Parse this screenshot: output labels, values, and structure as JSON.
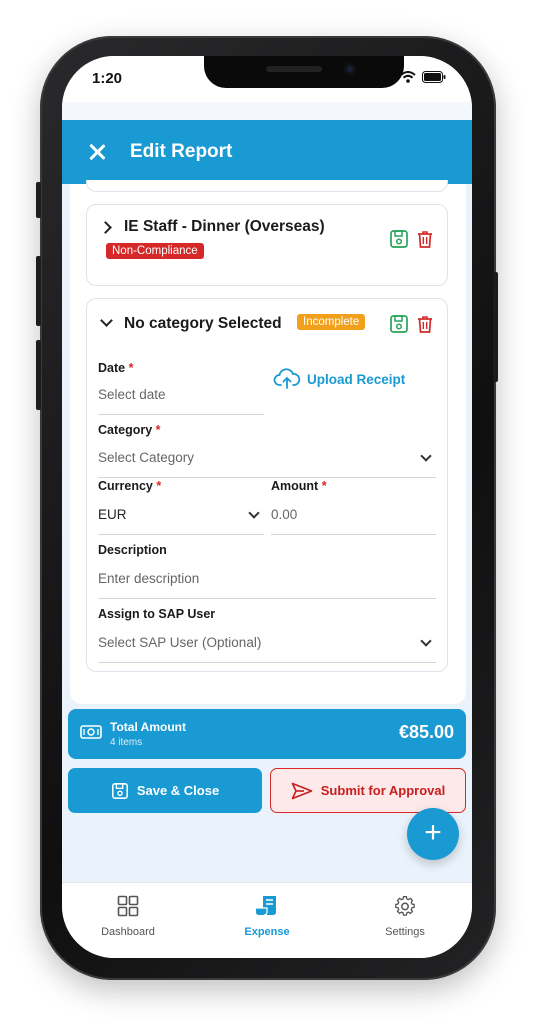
{
  "status_bar": {
    "time": "1:20"
  },
  "header": {
    "title": "Edit Report"
  },
  "expense_items": [
    {
      "title": "IE Staff - Dinner (Overseas)",
      "badge": "Non-Compliance",
      "expanded": false
    },
    {
      "title": "No category Selected",
      "badge": "Incomplete",
      "expanded": true
    }
  ],
  "form": {
    "date_label": "Date",
    "date_placeholder": "Select date",
    "upload_label": "Upload Receipt",
    "category_label": "Category",
    "category_placeholder": "Select Category",
    "currency_label": "Currency",
    "currency_value": "EUR",
    "amount_label": "Amount",
    "amount_placeholder": "0.00",
    "description_label": "Description",
    "description_placeholder": "Enter description",
    "sap_label": "Assign to SAP User",
    "sap_placeholder": "Select SAP User (Optional)",
    "required_mark": "*"
  },
  "summary": {
    "label": "Total Amount",
    "count": "4 items",
    "amount": "€85.00"
  },
  "actions": {
    "save_label": "Save & Close",
    "submit_label": "Submit for Approval",
    "fab_label": "+"
  },
  "nav": {
    "items": [
      {
        "label": "Dashboard",
        "icon": "grid-icon"
      },
      {
        "label": "Expense",
        "icon": "receipt-icon",
        "active": true
      },
      {
        "label": "Settings",
        "icon": "gear-icon"
      }
    ]
  },
  "colors": {
    "primary": "#1a9ad3",
    "danger": "#d62828",
    "warning": "#f2a01c",
    "success": "#27a35a"
  }
}
